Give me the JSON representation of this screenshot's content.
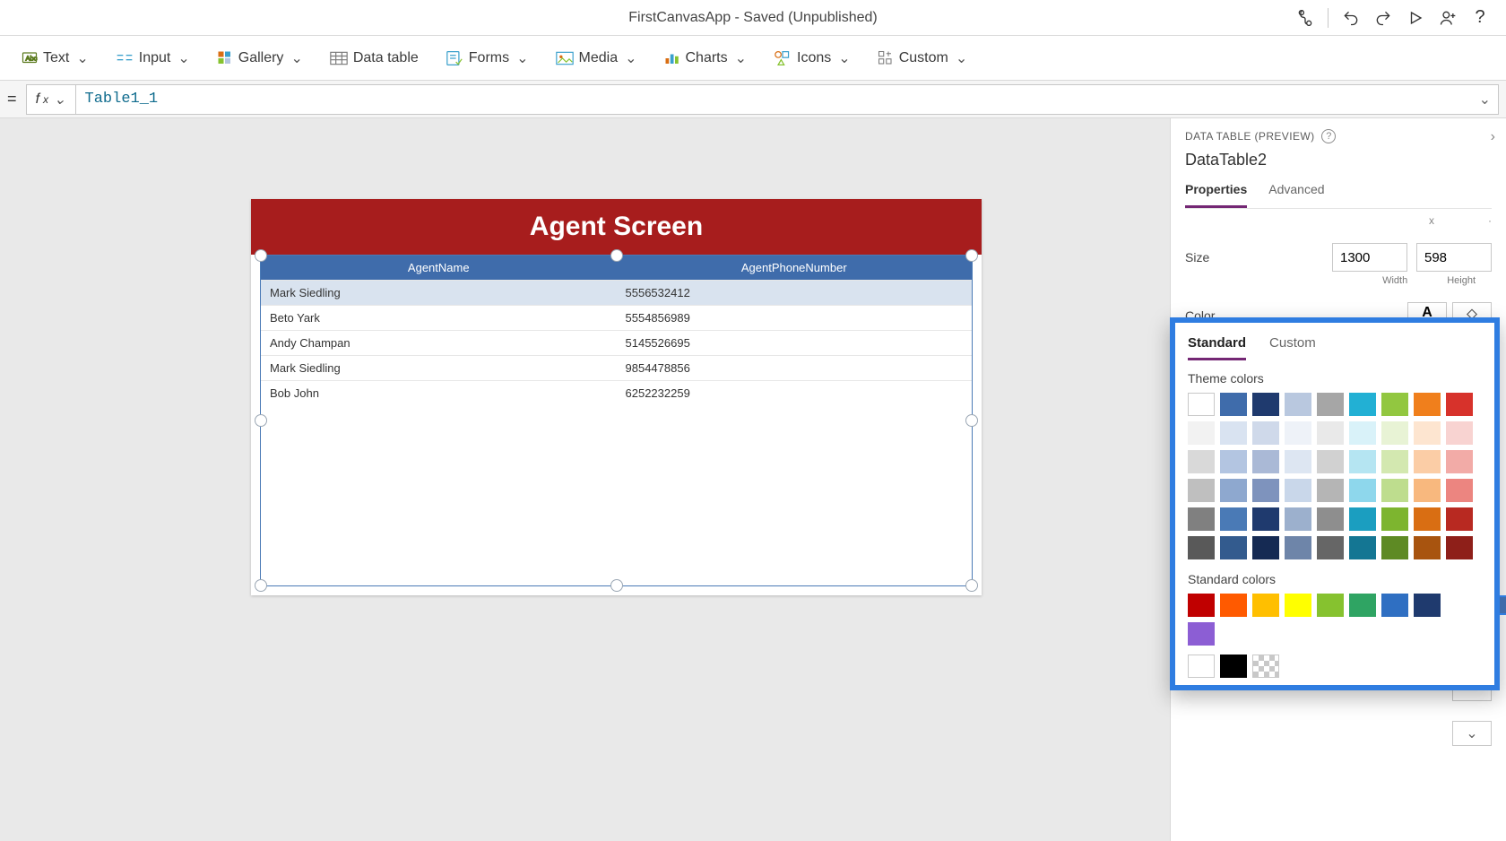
{
  "header": {
    "title": "FirstCanvasApp - Saved (Unpublished)"
  },
  "ribbon": {
    "text": "Text",
    "input": "Input",
    "gallery": "Gallery",
    "datatable": "Data table",
    "forms": "Forms",
    "media": "Media",
    "charts": "Charts",
    "icons": "Icons",
    "custom": "Custom"
  },
  "formula": {
    "expr": "Table1_1"
  },
  "canvas": {
    "screenTitle": "Agent Screen",
    "table": {
      "columns": [
        "AgentName",
        "AgentPhoneNumber"
      ],
      "rows": [
        {
          "name": "Mark Siedling",
          "phone": "5556532412"
        },
        {
          "name": "Beto Yark",
          "phone": "5554856989"
        },
        {
          "name": "Andy Champan",
          "phone": "5145526695"
        },
        {
          "name": "Mark Siedling",
          "phone": "9854478856"
        },
        {
          "name": "Bob John",
          "phone": "6252232259"
        }
      ]
    }
  },
  "panel": {
    "heading": "DATA TABLE (PREVIEW)",
    "objectName": "DataTable2",
    "tabs": {
      "properties": "Properties",
      "advanced": "Advanced"
    },
    "size": {
      "label": "Size",
      "width": "1300",
      "height": "598",
      "widthLabel": "Width",
      "heightLabel": "Height"
    },
    "colorLabel": "Color"
  },
  "colorPicker": {
    "tabStandard": "Standard",
    "tabCustom": "Custom",
    "themeTitle": "Theme colors",
    "standardTitle": "Standard colors",
    "themeColors": [
      "#ffffff",
      "#3f6cab",
      "#1f3a6e",
      "#b9c8df",
      "#a6a6a6",
      "#22b0d4",
      "#92c740",
      "#f07f1c",
      "#d7322b",
      "#f2f2f2",
      "#d9e3f1",
      "#cfd9ea",
      "#eef2f8",
      "#e9e9e9",
      "#d9f2f9",
      "#e8f3d5",
      "#fde5d0",
      "#f8d3d1",
      "#d9d9d9",
      "#b3c5e1",
      "#aab9d6",
      "#dde6f2",
      "#d1d1d1",
      "#b5e5f2",
      "#d3e8b0",
      "#fbcda6",
      "#f2aba7",
      "#bfbfbf",
      "#8ea8cf",
      "#7e93bd",
      "#c9d7ea",
      "#b5b5b5",
      "#8ed7ec",
      "#bedd8e",
      "#f8b87e",
      "#ec8580",
      "#808080",
      "#4a7ab6",
      "#1f3a6e",
      "#9cb0cd",
      "#8e8e8e",
      "#1b9ec0",
      "#7db52f",
      "#d96e13",
      "#b82921",
      "#595959",
      "#335b8e",
      "#152a53",
      "#6e85a9",
      "#666666",
      "#147693",
      "#5e8a24",
      "#a8540f",
      "#8e1f19"
    ],
    "standardColors": [
      "#c00000",
      "#ff5a00",
      "#ffbf00",
      "#ffff00",
      "#86c22f",
      "#2fa463",
      "#2f6fc2",
      "#1f3a6e",
      "#8c5ed4"
    ],
    "bw": [
      "#ffffff",
      "#000000",
      "transparent"
    ]
  },
  "rightSwatches": [
    "#1f3a6e",
    "",
    "#cfe0f5",
    "#000000",
    "#3f6cab",
    "#ffffff"
  ]
}
